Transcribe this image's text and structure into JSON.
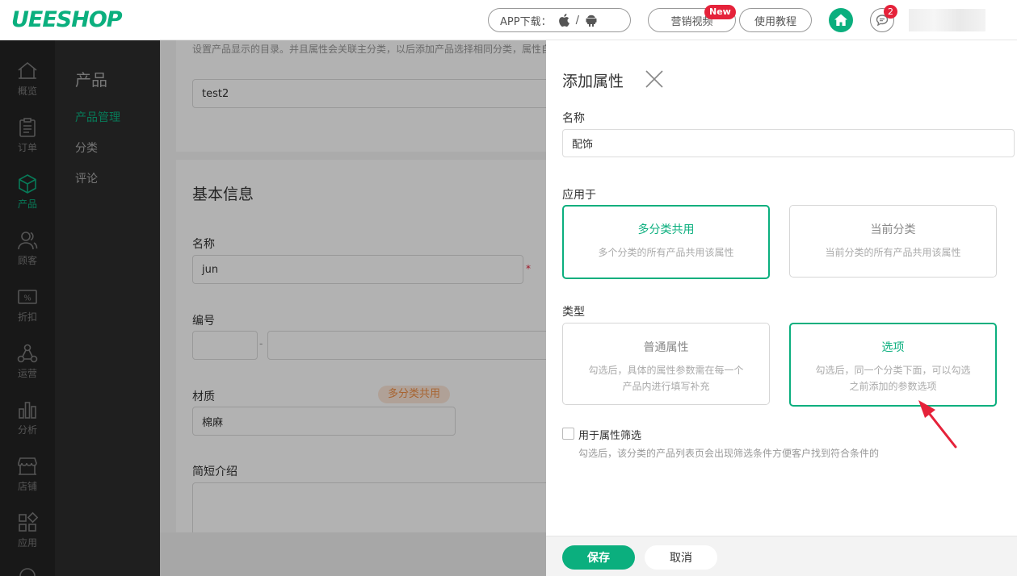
{
  "topbar": {
    "logo": "UEESHOP",
    "app_download": "APP下载：",
    "app_sep": "/",
    "marketing_video": "营销视频",
    "new_badge": "New",
    "tutorial": "使用教程",
    "message_count": "2",
    "accent": "#0baf7e",
    "alert_color": "#e5223a"
  },
  "rail": {
    "items": [
      {
        "label": "概览",
        "icon": "home-outline-icon"
      },
      {
        "label": "订单",
        "icon": "clipboard-icon"
      },
      {
        "label": "产品",
        "icon": "cube-icon"
      },
      {
        "label": "顾客",
        "icon": "users-icon"
      },
      {
        "label": "折扣",
        "icon": "discount-icon"
      },
      {
        "label": "运营",
        "icon": "network-icon"
      },
      {
        "label": "分析",
        "icon": "bar-chart-icon"
      },
      {
        "label": "店铺",
        "icon": "store-icon"
      },
      {
        "label": "应用",
        "icon": "apps-icon"
      }
    ],
    "active": "产品"
  },
  "subnav": {
    "title": "产品",
    "items": [
      "产品管理",
      "分类",
      "评论"
    ],
    "active": "产品管理"
  },
  "main": {
    "desc": "设置产品显示的目录。并且属性会关联主分类，以后添加产品选择相同分类，属性自",
    "category_value": "test2",
    "section_title": "基本信息",
    "name_label": "名称",
    "name_value": "jun",
    "required_mark": "*",
    "code_label": "编号",
    "code_sep": "-",
    "material_label": "材质",
    "material_tag": "多分类共用",
    "material_value": "棉麻",
    "brief_label": "简短介绍"
  },
  "drawer": {
    "title": "添加属性",
    "name_label": "名称",
    "name_value": "配饰",
    "apply_label": "应用于",
    "apply_options": [
      {
        "title": "多分类共用",
        "desc": "多个分类的所有产品共用该属性",
        "selected": true
      },
      {
        "title": "当前分类",
        "desc": "当前分类的所有产品共用该属性",
        "selected": false
      }
    ],
    "type_label": "类型",
    "type_options": [
      {
        "title": "普通属性",
        "desc1": "勾选后，具体的属性参数需在每一个",
        "desc2": "产品内进行填写补充",
        "selected": false
      },
      {
        "title": "选项",
        "desc1": "勾选后，同一个分类下面，可以勾选",
        "desc2": "之前添加的参数选项",
        "selected": true
      }
    ],
    "filter_label": "用于属性筛选",
    "filter_checked": false,
    "filter_hint": "勾选后，该分类的产品列表页会出现筛选条件方便客户找到符合条件的",
    "save": "保存",
    "cancel": "取消"
  }
}
